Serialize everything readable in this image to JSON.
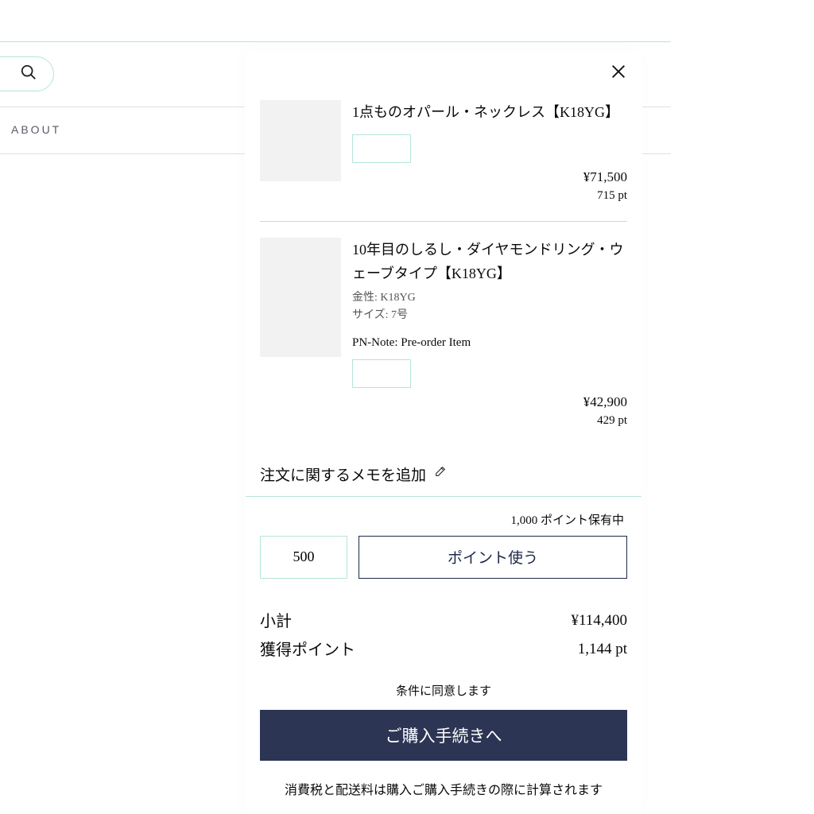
{
  "nav": {
    "about": "ABOUT"
  },
  "cart": {
    "items": [
      {
        "title": "1点ものオパール・ネックレス【K18YG】",
        "meta": "",
        "note": "",
        "price": "¥71,500",
        "points": "715 pt"
      },
      {
        "title": "10年目のしるし・ダイヤモンドリング・ウェーブタイプ【K18YG】",
        "meta_metal": "金性: K18YG",
        "meta_size": "サイズ: 7号",
        "note": "PN-Note: Pre-order Item",
        "price": "¥42,900",
        "points": "429 pt"
      }
    ],
    "order_note_label": "注文に関するメモを追加",
    "points_held": "1,000 ポイント保有中",
    "points_input_value": "500",
    "use_points_label": "ポイント使う",
    "subtotal_label": "小計",
    "subtotal_value": "¥114,400",
    "earn_points_label": "獲得ポイント",
    "earn_points_value": "1,144 pt",
    "agree_text": "条件に同意します",
    "checkout_label": "ご購入手続きへ",
    "disclaimer": "消費税と配送料は購入ご購入手続きの際に計算されます"
  }
}
